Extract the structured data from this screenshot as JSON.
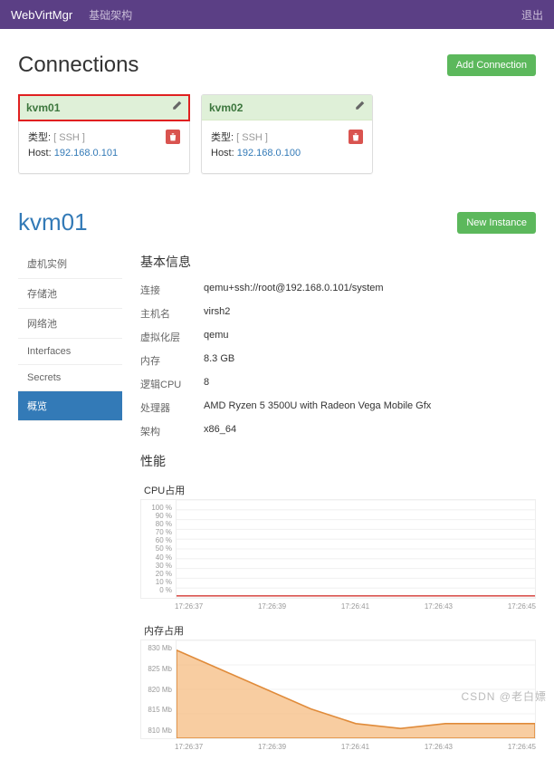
{
  "nav": {
    "brand": "WebVirtMgr",
    "link1": "基础架构",
    "logout": "退出"
  },
  "connections": {
    "title": "Connections",
    "add_btn": "Add Connection",
    "cards": [
      {
        "name": "kvm01",
        "type_label": "类型:",
        "type_value": "[ SSH ]",
        "host_label": "Host:",
        "host_value": "192.168.0.101",
        "highlight": true
      },
      {
        "name": "kvm02",
        "type_label": "类型:",
        "type_value": "[ SSH ]",
        "host_label": "Host:",
        "host_value": "192.168.0.100",
        "highlight": false
      }
    ]
  },
  "host": {
    "name": "kvm01",
    "new_instance": "New Instance",
    "sidebar": [
      "虚机实例",
      "存储池",
      "网络池",
      "Interfaces",
      "Secrets",
      "概览"
    ],
    "active_index": 5,
    "basic_info_title": "基本信息",
    "info": [
      {
        "k": "连接",
        "v": "qemu+ssh://root@192.168.0.101/system"
      },
      {
        "k": "主机名",
        "v": "virsh2"
      },
      {
        "k": "虚拟化层",
        "v": "qemu"
      },
      {
        "k": "内存",
        "v": "8.3 GB"
      },
      {
        "k": "逻辑CPU",
        "v": "8"
      },
      {
        "k": "处理器",
        "v": "AMD Ryzen 5 3500U with Radeon Vega Mobile Gfx"
      },
      {
        "k": "架构",
        "v": "x86_64"
      }
    ],
    "perf_title": "性能"
  },
  "chart_data": [
    {
      "type": "line",
      "title": "CPU占用",
      "y_ticks": [
        "100 %",
        "90 %",
        "80 %",
        "70 %",
        "60 %",
        "50 %",
        "40 %",
        "30 %",
        "20 %",
        "10 %",
        "0 %"
      ],
      "x_ticks": [
        "17:26:37",
        "17:26:39",
        "17:26:41",
        "17:26:43",
        "17:26:45"
      ],
      "ylim": [
        0,
        100
      ],
      "x": [
        "17:26:37",
        "17:26:38",
        "17:26:39",
        "17:26:40",
        "17:26:41",
        "17:26:42",
        "17:26:43",
        "17:26:44",
        "17:26:45"
      ],
      "values": [
        2,
        2,
        2,
        2,
        2,
        2,
        2,
        2,
        2
      ],
      "stroke": "#d9534f",
      "fill": "none"
    },
    {
      "type": "area",
      "title": "内存占用",
      "y_ticks": [
        "830 Mb",
        "825 Mb",
        "820 Mb",
        "815 Mb",
        "810 Mb"
      ],
      "x_ticks": [
        "17:26:37",
        "17:26:39",
        "17:26:41",
        "17:26:43",
        "17:26:45"
      ],
      "ylim": [
        810,
        830
      ],
      "x": [
        "17:26:37",
        "17:26:38",
        "17:26:39",
        "17:26:40",
        "17:26:41",
        "17:26:42",
        "17:26:43",
        "17:26:44",
        "17:26:45"
      ],
      "values": [
        828,
        824,
        820,
        816,
        813,
        812,
        813,
        813,
        813
      ],
      "stroke": "#e08b3a",
      "fill": "#f5b879"
    }
  ],
  "watermark": "CSDN @老白嫖"
}
